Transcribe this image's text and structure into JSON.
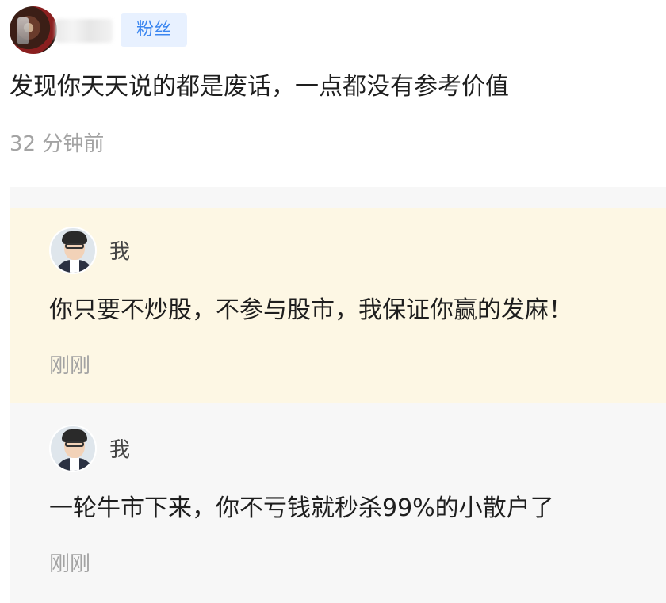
{
  "comment": {
    "badge": "粉丝",
    "text": "发现你天天说的都是废话，一点都没有参考价值",
    "time": "32 分钟前"
  },
  "replies": [
    {
      "name": "我",
      "text": "你只要不炒股，不参与股市，我保证你赢的发麻！",
      "time": "刚刚",
      "highlighted": true
    },
    {
      "name": "我",
      "text": "一轮牛市下来，你不亏钱就秒杀99%的小散户了",
      "time": "刚刚",
      "highlighted": false
    }
  ],
  "colors": {
    "badge_bg": "#e8f1ff",
    "badge_text": "#3b86f0",
    "highlight_bg": "#fdf7e4",
    "reply_bg": "#f7f7f7",
    "muted_text": "#a3a3a3"
  },
  "icons": {
    "commenter_avatar": "avatar-image",
    "reply_avatar": "avatar-image"
  }
}
